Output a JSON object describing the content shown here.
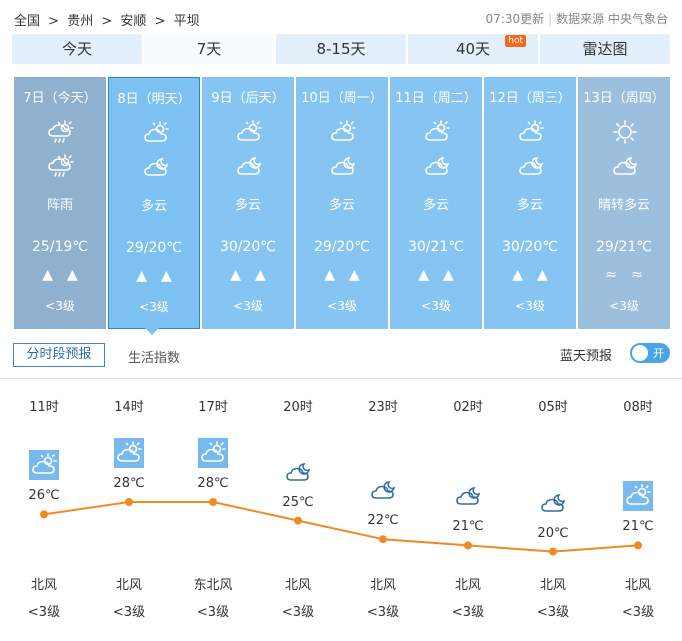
{
  "breadcrumb": [
    "全国",
    ">",
    "贵州",
    ">",
    "安顺",
    ">",
    "平坝"
  ],
  "update": {
    "time": "07:30更新",
    "source": "数据来源 中央气象台"
  },
  "tabs": [
    {
      "label": "今天"
    },
    {
      "label": "7天",
      "active": true
    },
    {
      "label": "8-15天"
    },
    {
      "label": "40天",
      "badge": "hot"
    },
    {
      "label": "雷达图"
    }
  ],
  "days": [
    {
      "date": "7日（今天）",
      "icon1": "cloud-rain-icon",
      "icon2": "cloud-rain-icon",
      "weather": "阵雨",
      "temp": "25/19℃",
      "wind": "▲▲",
      "level": "<3级",
      "style": "today"
    },
    {
      "date": "8日（明天）",
      "icon1": "partly-cloudy-day-icon",
      "icon2": "partly-cloudy-night-icon",
      "weather": "多云",
      "temp": "29/20℃",
      "wind": "▲▲",
      "level": "<3级",
      "style": "sel"
    },
    {
      "date": "9日（后天）",
      "icon1": "partly-cloudy-day-icon",
      "icon2": "partly-cloudy-night-icon",
      "weather": "多云",
      "temp": "30/20℃",
      "wind": "▲▲",
      "level": "<3级",
      "style": "normal"
    },
    {
      "date": "10日（周一）",
      "icon1": "partly-cloudy-day-icon",
      "icon2": "partly-cloudy-night-icon",
      "weather": "多云",
      "temp": "29/20℃",
      "wind": "▲▲",
      "level": "<3级",
      "style": "normal"
    },
    {
      "date": "11日（周二）",
      "icon1": "partly-cloudy-day-icon",
      "icon2": "partly-cloudy-night-icon",
      "weather": "多云",
      "temp": "30/21℃",
      "wind": "▲▲",
      "level": "<3级",
      "style": "normal"
    },
    {
      "date": "12日（周三）",
      "icon1": "partly-cloudy-day-icon",
      "icon2": "partly-cloudy-night-icon",
      "weather": "多云",
      "temp": "30/20℃",
      "wind": "▲▲",
      "level": "<3级",
      "style": "normal"
    },
    {
      "date": "13日（周四）",
      "icon1": "sun-icon",
      "icon2": "partly-cloudy-night-icon",
      "weather": "晴转多云",
      "temp": "29/21℃",
      "wind": "≈≈",
      "level": "<3级",
      "style": "last"
    }
  ],
  "subtabs": {
    "hourly": "分时段预报",
    "life": "生活指数"
  },
  "bluesky": {
    "label": "蓝天预报",
    "toggle": "开"
  },
  "hourly": [
    {
      "time": "11时",
      "temp": "26℃",
      "t": 26,
      "icon": "partly-cloudy-day-icon",
      "boxed": true,
      "wind": "北风",
      "level": "<3级"
    },
    {
      "time": "14时",
      "temp": "28℃",
      "t": 28,
      "icon": "partly-cloudy-day-icon",
      "boxed": true,
      "wind": "北风",
      "level": "<3级"
    },
    {
      "time": "17时",
      "temp": "28℃",
      "t": 28,
      "icon": "partly-cloudy-day-icon",
      "boxed": true,
      "wind": "东北风",
      "level": "<3级"
    },
    {
      "time": "20时",
      "temp": "25℃",
      "t": 25,
      "icon": "partly-cloudy-night-icon",
      "boxed": false,
      "wind": "北风",
      "level": "<3级"
    },
    {
      "time": "23时",
      "temp": "22℃",
      "t": 22,
      "icon": "partly-cloudy-night-icon",
      "boxed": false,
      "wind": "北风",
      "level": "<3级"
    },
    {
      "time": "02时",
      "temp": "21℃",
      "t": 21,
      "icon": "partly-cloudy-night-icon",
      "boxed": false,
      "wind": "北风",
      "level": "<3级"
    },
    {
      "time": "05时",
      "temp": "20℃",
      "t": 20,
      "icon": "partly-cloudy-night-icon",
      "boxed": false,
      "wind": "北风",
      "level": "<3级"
    },
    {
      "time": "08时",
      "temp": "21℃",
      "t": 21,
      "icon": "partly-cloudy-day-icon",
      "boxed": true,
      "wind": "北风",
      "level": "<3级"
    }
  ],
  "colors": {
    "line": "#f08a24",
    "accent": "#2f86c7"
  }
}
